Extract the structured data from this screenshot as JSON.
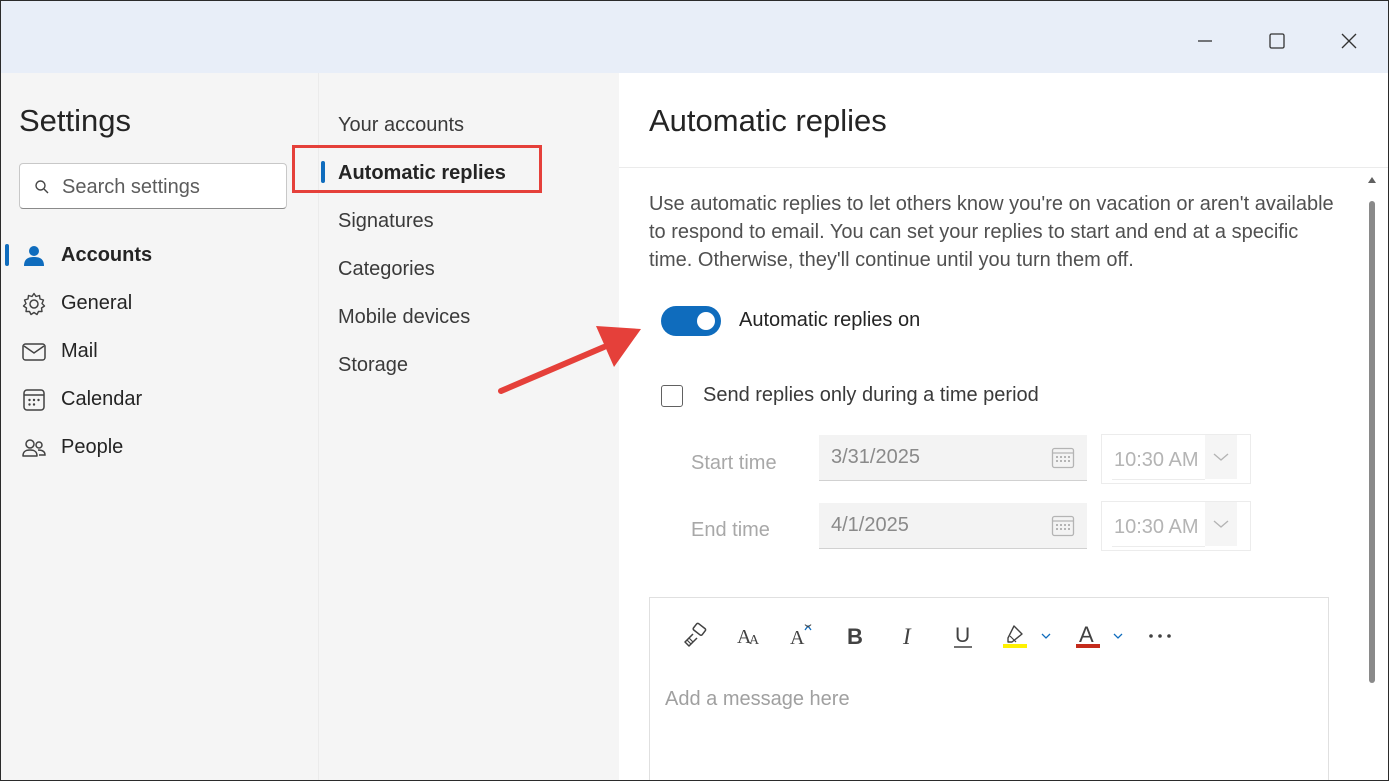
{
  "window": {
    "minimize_icon": "minimize-icon",
    "maximize_icon": "maximize-icon",
    "close_icon": "close-icon"
  },
  "nav": {
    "title": "Settings",
    "search": {
      "placeholder": "Search settings",
      "value": "",
      "icon": "search-icon"
    },
    "items": [
      {
        "label": "Accounts",
        "icon": "person-icon",
        "active": true
      },
      {
        "label": "General",
        "icon": "gear-icon",
        "active": false
      },
      {
        "label": "Mail",
        "icon": "mail-icon",
        "active": false
      },
      {
        "label": "Calendar",
        "icon": "calendar-icon",
        "active": false
      },
      {
        "label": "People",
        "icon": "people-icon",
        "active": false
      }
    ]
  },
  "subnav": {
    "items": [
      {
        "label": "Your accounts",
        "active": false
      },
      {
        "label": "Automatic replies",
        "active": true
      },
      {
        "label": "Signatures",
        "active": false
      },
      {
        "label": "Categories",
        "active": false
      },
      {
        "label": "Mobile devices",
        "active": false
      },
      {
        "label": "Storage",
        "active": false
      }
    ]
  },
  "main": {
    "title": "Automatic replies",
    "description": "Use automatic replies to let others know you're on vacation or aren't available to respond to email. You can set your replies to start and end at a specific time. Otherwise, they'll continue until you turn them off.",
    "toggle": {
      "label": "Automatic replies on",
      "on": true
    },
    "time_period": {
      "label": "Send replies only during a time period",
      "checked": false
    },
    "start": {
      "label": "Start time",
      "date": "3/31/2025",
      "time": "10:30 AM"
    },
    "end": {
      "label": "End time",
      "date": "4/1/2025",
      "time": "10:30 AM"
    },
    "editor": {
      "placeholder": "Add a message here",
      "toolbar": [
        "format-painter-icon",
        "font-size-icon",
        "superscript-icon",
        "bold-icon",
        "italic-icon",
        "underline-icon",
        "highlight-icon",
        "font-color-icon",
        "more-icon"
      ]
    }
  },
  "colors": {
    "accent": "#0f6cbd",
    "annotation": "#e5403a",
    "titlebar": "#e8eef8",
    "highlight_yellow": "#fff100",
    "font_red": "#c42b1c"
  }
}
